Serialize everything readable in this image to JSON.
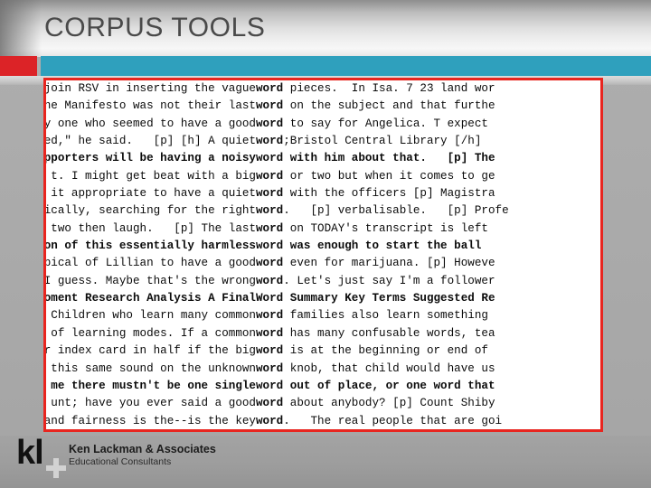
{
  "slide": {
    "title": "CORPUS TOOLS",
    "accent_red": "#dc2327",
    "accent_teal": "#2fa0bd",
    "panel_border": "#e8251f"
  },
  "concordance": {
    "keyword": "word",
    "lines": [
      {
        "left": "join RSV in inserting the vague ",
        "kw": "word",
        "right": " pieces.  In Isa. 7 23 land wor",
        "bold": false
      },
      {
        "left": "ne Manifesto was not their last ",
        "kw": "word",
        "right": " on the subject and that furthe",
        "bold": false
      },
      {
        "left": "y one who seemed to have a good ",
        "kw": "word",
        "right": " to say for Angelica. T expect",
        "bold": false
      },
      {
        "left": "ted,\" he said.   [p] [h] A quiet ",
        "kw": "word",
        "right": ";Bristol Central Library [/h]",
        "bold": false
      },
      {
        "left": "pporters will be having a noisy ",
        "kw": "word",
        "right": " with him about that.   [p] The",
        "bold": true
      },
      {
        "left": "t. I might get beat with a big ",
        "kw": "word",
        "right": " or two but when it comes to ge",
        "bold": false
      },
      {
        "left": " it appropriate to have a quiet ",
        "kw": "word",
        "right": " with the officers [p] Magistra",
        "bold": false
      },
      {
        "left": "ically, searching for the right ",
        "kw": "word",
        "right": ".   [p] verbalisable.   [p] Profe",
        "bold": false
      },
      {
        "left": "e two then laugh.   [p] The last ",
        "kw": "word",
        "right": " on TODAY's transcript is left",
        "bold": false
      },
      {
        "left": "on of this essentially harmless ",
        "kw": "word",
        "right": " was enough to start the ball",
        "bold": true
      },
      {
        "left": "pical of Lillian to have a good ",
        "kw": "word",
        "right": " even for marijuana. [p] Howeve",
        "bold": false
      },
      {
        "left": "I guess. Maybe that's the wrong ",
        "kw": "word",
        "right": ". Let's just say I'm a follower",
        "bold": false
      },
      {
        "left": "oment Research Analysis A Final ",
        "kw": "Word",
        "right": " Summary Key Terms Suggested Re",
        "bold": true
      },
      {
        "left": " Children who learn many common ",
        "kw": "word",
        "right": " families also learn something",
        "bold": false
      },
      {
        "left": " of learning modes. If a common ",
        "kw": "word",
        "right": " has many confusable words, tea",
        "bold": false
      },
      {
        "left": "r index card in half if the big ",
        "kw": "word",
        "right": " is at the beginning or end of",
        "bold": false
      },
      {
        "left": " this same sound on the unknown ",
        "kw": "word",
        "right": " knob, that child would have us",
        "bold": false
      },
      {
        "left": "me there mustn't be one single ",
        "kw": "word",
        "right": " out of place, or one word that",
        "bold": true
      },
      {
        "left": "unt; have you ever said a good ",
        "kw": "word",
        "right": " about anybody? [p] Count Shiby",
        "bold": false
      },
      {
        "left": "and fairness is the--is the key ",
        "kw": "word",
        "right": ".   The real people that are goi",
        "bold": false
      }
    ]
  },
  "footer": {
    "logo_text": "kl",
    "logo_plus": "+",
    "company": "Ken Lackman & Associates",
    "tagline": "Educational Consultants"
  }
}
